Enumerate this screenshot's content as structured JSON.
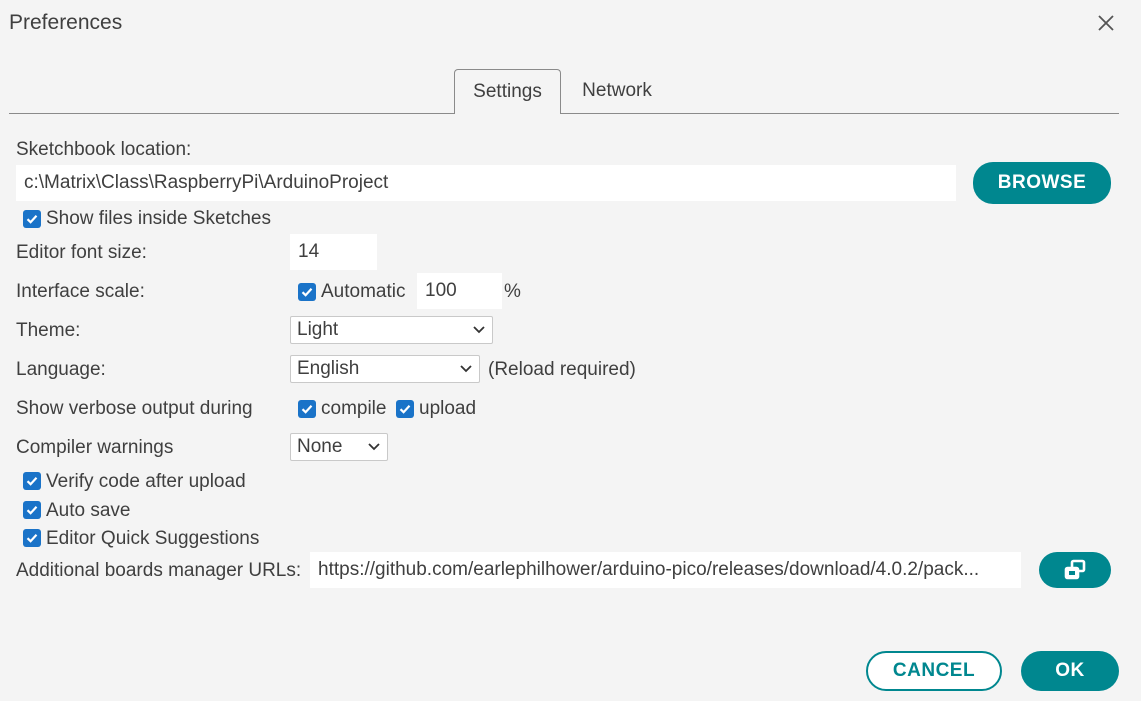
{
  "dialog": {
    "title": "Preferences"
  },
  "tabs": [
    {
      "label": "Settings"
    },
    {
      "label": "Network"
    }
  ],
  "sketchbook": {
    "label": "Sketchbook location:",
    "path": "c:\\Matrix\\Class\\RaspberryPi\\ArduinoProject",
    "browse_label": "BROWSE",
    "show_files_label": "Show files inside Sketches",
    "show_files_checked": true
  },
  "font_size": {
    "label": "Editor font size:",
    "value": "14"
  },
  "interface_scale": {
    "label": "Interface scale:",
    "automatic_label": "Automatic",
    "automatic_checked": true,
    "value": "100",
    "unit": "%"
  },
  "theme": {
    "label": "Theme:",
    "value": "Light"
  },
  "language": {
    "label": "Language:",
    "value": "English",
    "note": "(Reload required)"
  },
  "verbose": {
    "label": "Show verbose output during",
    "compile_label": "compile",
    "compile_checked": true,
    "upload_label": "upload",
    "upload_checked": true
  },
  "compiler_warnings": {
    "label": "Compiler warnings",
    "value": "None"
  },
  "options": [
    {
      "label": "Verify code after upload",
      "checked": true
    },
    {
      "label": "Auto save",
      "checked": true
    },
    {
      "label": "Editor Quick Suggestions",
      "checked": true
    }
  ],
  "boards_urls": {
    "label": "Additional boards manager URLs:",
    "value": "https://github.com/earlephilhower/arduino-pico/releases/download/4.0.2/pack..."
  },
  "footer": {
    "cancel_label": "CANCEL",
    "ok_label": "OK"
  },
  "colors": {
    "accent": "#00878f",
    "checkbox": "#1a73c8",
    "background": "#f4f4f4"
  }
}
